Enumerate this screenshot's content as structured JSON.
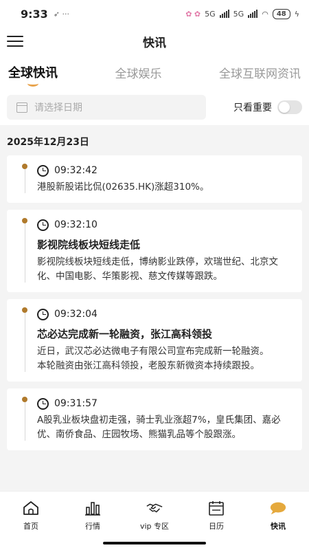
{
  "status_bar": {
    "time": "9:33",
    "battery": "48",
    "network": "5G"
  },
  "header": {
    "title": "快讯"
  },
  "tabs": [
    {
      "label": "全球快讯",
      "active": true
    },
    {
      "label": "全球娱乐",
      "active": false
    },
    {
      "label": "全球互联网资讯",
      "active": false
    }
  ],
  "filter": {
    "date_placeholder": "请选择日期",
    "important_only_label": "只看重要",
    "important_only_on": false
  },
  "date_heading": "2025年12月23日",
  "news": [
    {
      "time": "09:32:42",
      "title": "",
      "body": [
        "港股新股诺比侃(02635.HK)涨超310%。"
      ]
    },
    {
      "time": "09:32:10",
      "title": "影视院线板块短线走低",
      "body": [
        "影视院线板块短线走低，博纳影业跌停，欢瑞世纪、北京文化、中国电影、华策影视、慈文传媒等跟跌。"
      ]
    },
    {
      "time": "09:32:04",
      "title": "芯必达完成新一轮融资，张江高科领投",
      "body": [
        "近日，武汉芯必达微电子有限公司宣布完成新一轮融资。",
        "本轮融资由张江高科领投，老股东新微资本持续跟投。"
      ]
    },
    {
      "time": "09:31:57",
      "title": "",
      "body": [
        "A股乳业板块盘初走强，骑士乳业涨超7%，皇氏集团、嘉必优、南侨食品、庄园牧场、熊猫乳品等个股跟涨。"
      ]
    }
  ],
  "tabbar": [
    {
      "label": "首页",
      "icon": "home-icon"
    },
    {
      "label": "行情",
      "icon": "chart-icon"
    },
    {
      "label": "vip 专区",
      "icon": "handshake-icon"
    },
    {
      "label": "日历",
      "icon": "calendar-icon"
    },
    {
      "label": "快讯",
      "icon": "chat-bubble-icon",
      "active": true
    }
  ],
  "colors": {
    "accent": "#e8a24a",
    "timeline_dot": "#b07a2c",
    "chat_icon": "#e5a93d"
  }
}
